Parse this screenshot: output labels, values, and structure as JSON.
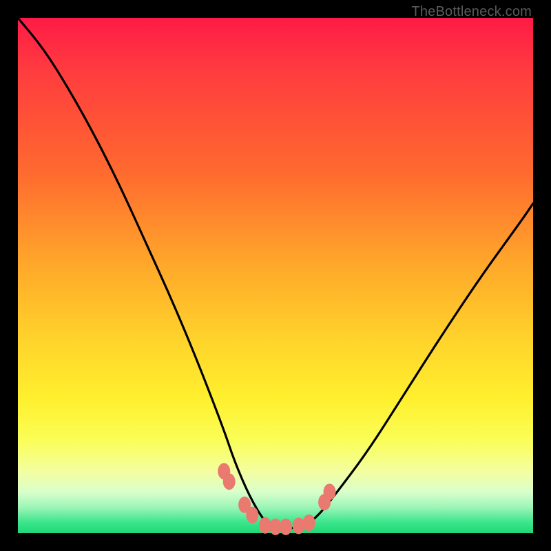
{
  "watermark": "TheBottleneck.com",
  "chart_data": {
    "type": "line",
    "title": "",
    "xlabel": "",
    "ylabel": "",
    "xlim": [
      0,
      100
    ],
    "ylim": [
      0,
      100
    ],
    "series": [
      {
        "name": "bottleneck-curve",
        "x": [
          0,
          5,
          10,
          15,
          20,
          25,
          30,
          35,
          40,
          42,
          45,
          48,
          50,
          52,
          55,
          58,
          62,
          68,
          75,
          82,
          90,
          98,
          100
        ],
        "values": [
          100,
          94,
          86,
          77,
          67,
          56,
          45,
          33,
          20,
          14,
          7,
          2,
          1,
          1,
          1,
          3,
          8,
          16,
          27,
          38,
          50,
          61,
          64
        ]
      }
    ],
    "markers": {
      "name": "highlighted-points",
      "color": "#ea796f",
      "points": [
        {
          "x": 40.0,
          "y": 12.0
        },
        {
          "x": 41.0,
          "y": 10.0
        },
        {
          "x": 44.0,
          "y": 5.5
        },
        {
          "x": 45.5,
          "y": 3.5
        },
        {
          "x": 48.0,
          "y": 1.5
        },
        {
          "x": 50.0,
          "y": 1.2
        },
        {
          "x": 52.0,
          "y": 1.2
        },
        {
          "x": 54.5,
          "y": 1.4
        },
        {
          "x": 56.5,
          "y": 2.0
        },
        {
          "x": 59.5,
          "y": 6.0
        },
        {
          "x": 60.5,
          "y": 8.0
        }
      ]
    },
    "gradient_stops": [
      {
        "pos": 0.0,
        "color": "#ff1a46"
      },
      {
        "pos": 0.3,
        "color": "#ff6a2f"
      },
      {
        "pos": 0.62,
        "color": "#ffd22b"
      },
      {
        "pos": 0.82,
        "color": "#fafe57"
      },
      {
        "pos": 0.95,
        "color": "#9cf5b8"
      },
      {
        "pos": 1.0,
        "color": "#1fd878"
      }
    ]
  }
}
